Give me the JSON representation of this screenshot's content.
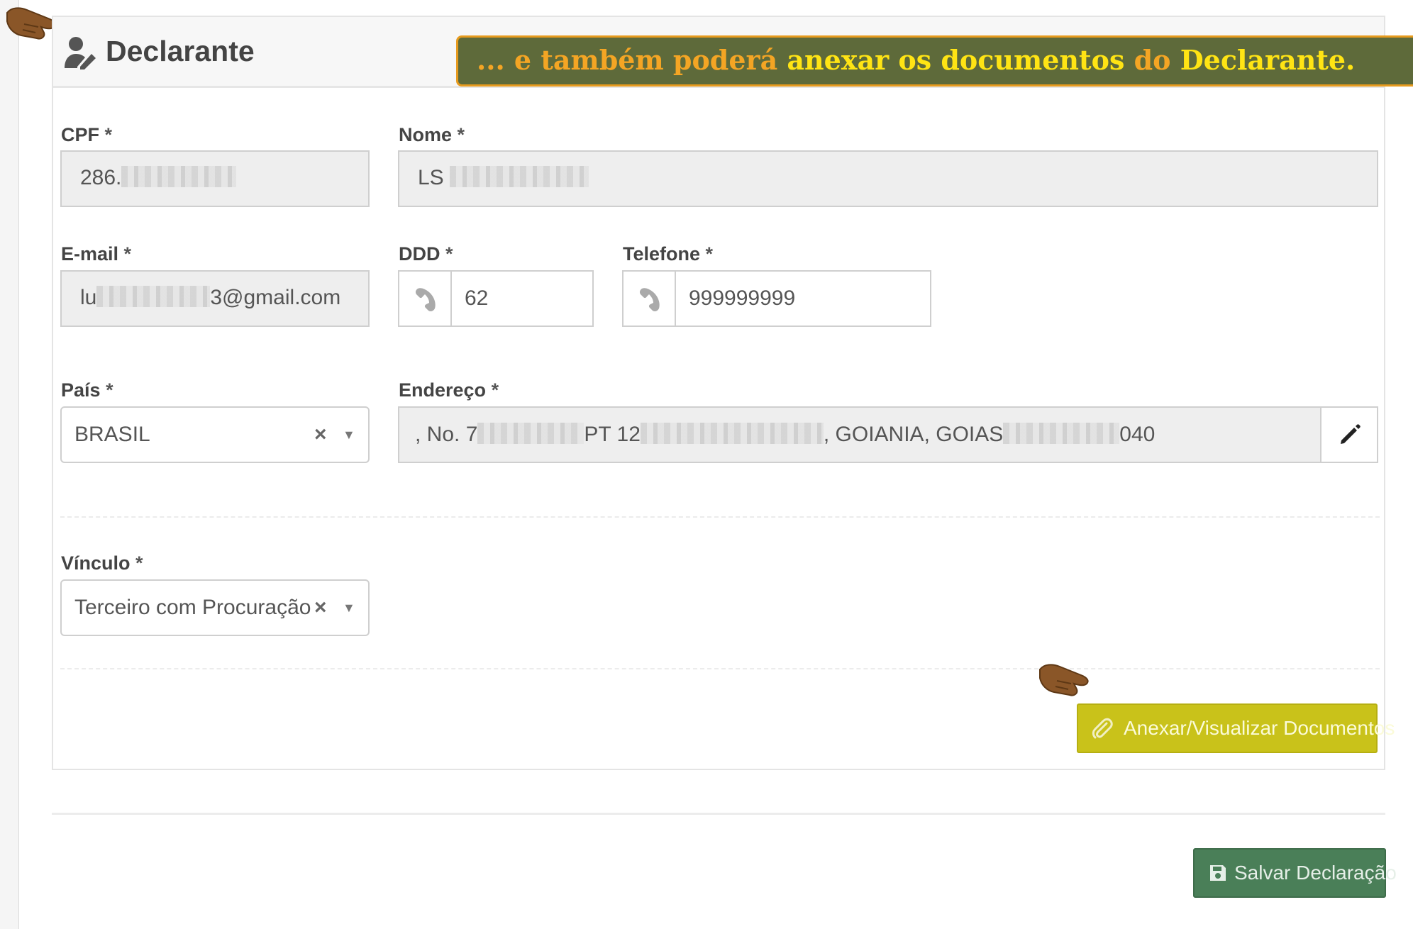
{
  "section": {
    "title": "Declarante",
    "icon": "user-edit-icon"
  },
  "banner": {
    "part1": "... e também poderá",
    "part2": " anexar os documentos ",
    "part3": "do",
    "part4": " Declarante.",
    "colors": {
      "background": "#5e6a3a",
      "border": "#e79b1e",
      "orange": "#f4a524",
      "yellow": "#ffe414"
    }
  },
  "fields": {
    "cpf": {
      "label": "CPF",
      "required": "*",
      "value_prefix": "286."
    },
    "nome": {
      "label": "Nome",
      "required": "*",
      "value_prefix": "LS"
    },
    "email": {
      "label": "E-mail",
      "required": "*",
      "value_prefix": "lu",
      "value_suffix": "3@gmail.com"
    },
    "ddd": {
      "label": "DDD",
      "required": "*",
      "value": "62",
      "icon": "phone-icon"
    },
    "telefone": {
      "label": "Telefone",
      "required": "*",
      "value": "999999999",
      "icon": "phone-icon"
    },
    "pais": {
      "label": "País",
      "required": "*",
      "value": "BRASIL",
      "clear": "×",
      "caret": "▼"
    },
    "endereco": {
      "label": "Endereço",
      "required": "*",
      "value_part1": ", No. 7",
      "value_part2": "PT 12",
      "value_part3": ", GOIANIA, GOIAS",
      "value_part4": "040",
      "edit_icon": "pencil-icon"
    },
    "vinculo": {
      "label": "Vínculo",
      "required": "*",
      "value": "Terceiro com Procuração",
      "clear": "×",
      "caret": "▼"
    }
  },
  "buttons": {
    "attach": {
      "label": "Anexar/Visualizar Documentos",
      "icon": "paperclip-icon",
      "color": "#c9c21a"
    },
    "save": {
      "label": "Salvar Declaração",
      "icon": "floppy-disk-icon",
      "color": "#4a7f58"
    }
  },
  "pointers": [
    "pointing-hand-icon",
    "pointing-hand-icon"
  ]
}
